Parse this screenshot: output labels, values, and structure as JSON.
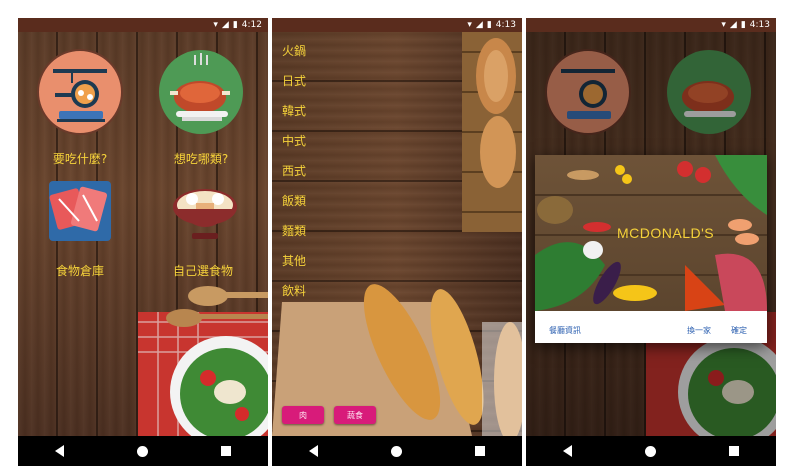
{
  "status": {
    "time_1": "4:12",
    "time_2": "4:13",
    "time_3": "4:13"
  },
  "screen1": {
    "what_to_eat": "要吃什麼?",
    "what_type": "想吃哪類?",
    "food_storage": "食物倉庫",
    "choose_food": "自己選食物"
  },
  "screen2": {
    "categories": [
      "火鍋",
      "日式",
      "韓式",
      "中式",
      "西式",
      "飯類",
      "麵類",
      "其他",
      "飲料"
    ],
    "btn_left": "肉",
    "btn_right": "蔬食"
  },
  "screen3": {
    "restaurant_name": "MCDONALD'S",
    "info_button": "餐廳資訊",
    "change_button": "換一家",
    "confirm_button": "確定"
  },
  "colors": {
    "accent_yellow": "#f5d23a",
    "pink_button": "#d81b7a",
    "link_blue": "#2b5fb0",
    "statusbar": "#5a2c1d"
  }
}
